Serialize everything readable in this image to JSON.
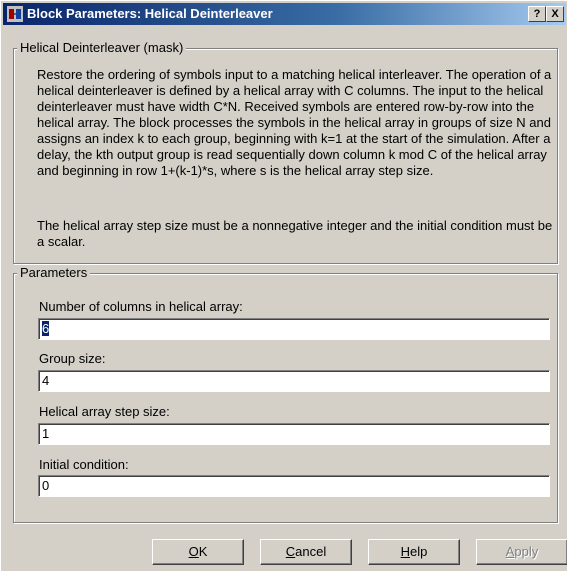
{
  "window": {
    "title": "Block Parameters: Helical Deinterleaver",
    "help_glyph": "?",
    "close_glyph": "X"
  },
  "description": {
    "legend": "Helical Deinterleaver (mask)",
    "paragraph1": "Restore the ordering of symbols input to a matching helical interleaver.  The operation of a helical deinterleaver is defined by a helical array with C columns.  The input to the helical deinterleaver must have width C*N.  Received symbols are entered row-by-row into the helical array.  The block processes the symbols in the helical array in groups of size N and assigns an index k to each group, beginning with k=1 at the start of the simulation.  After a delay, the kth output group is read sequentially down column k mod C of the helical array and beginning in row 1+(k-1)*s, where s is the helical array step size.",
    "paragraph2": "The helical array step size must be a nonnegative integer and the initial condition must be a scalar."
  },
  "parameters": {
    "legend": "Parameters",
    "fields": [
      {
        "label": "Number of columns in helical array:",
        "value": "6"
      },
      {
        "label": "Group size:",
        "value": "4"
      },
      {
        "label": "Helical array step size:",
        "value": "1"
      },
      {
        "label": "Initial condition:",
        "value": "0"
      }
    ]
  },
  "buttons": {
    "ok": {
      "mnemonic": "O",
      "rest": "K"
    },
    "cancel": {
      "mnemonic": "C",
      "rest": "ancel"
    },
    "help": {
      "mnemonic": "H",
      "rest": "elp"
    },
    "apply": {
      "mnemonic": "A",
      "rest": "pply"
    }
  },
  "colors": {
    "face": "#d4d0c8",
    "title_start": "#0a246a",
    "title_end": "#a6caf0"
  }
}
